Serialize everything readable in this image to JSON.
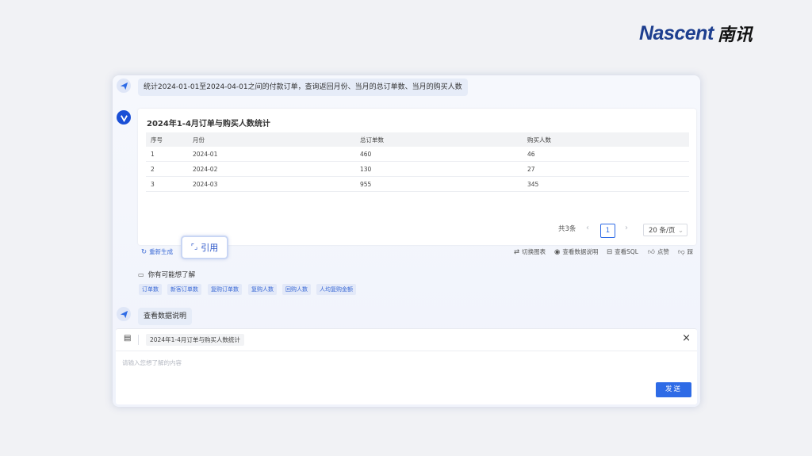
{
  "brand": {
    "en": "Nascent",
    "cn": "南讯"
  },
  "query": "统计2024-01-01至2024-04-01之间的付款订单，查询返回月份、当月的总订单数、当月的购买人数",
  "result": {
    "title": "2024年1-4月订单与购买人数统计",
    "columns": [
      "序号",
      "月份",
      "总订单数",
      "购买人数"
    ],
    "rows": [
      [
        "1",
        "2024-01",
        "460",
        "46"
      ],
      [
        "2",
        "2024-02",
        "130",
        "27"
      ],
      [
        "3",
        "2024-03",
        "955",
        "345"
      ]
    ],
    "pager": {
      "total": "共3条",
      "prev": "‹",
      "current": "1",
      "next": "›",
      "size": "20 条/页"
    }
  },
  "actions": {
    "regenerate": "重新生成",
    "cite": "引用",
    "switch_chart": "切换图表",
    "view_desc": "查看数据说明",
    "view_sql": "查看SQL",
    "like": "点赞",
    "dislike": "踩"
  },
  "suggestions": {
    "title": "你有可能想了解",
    "tags": [
      "订单数",
      "新客订单数",
      "复购订单数",
      "复购人数",
      "回购人数",
      "人均复购金额"
    ]
  },
  "followup": "查看数据说明",
  "composer": {
    "reference": "2024年1-4月订单与购买人数统计",
    "placeholder": "请输入您想了解的内容",
    "send": "发送",
    "close": "×"
  },
  "colors": {
    "accent": "#2e6be6",
    "brand_blue": "#1e3f8f"
  }
}
